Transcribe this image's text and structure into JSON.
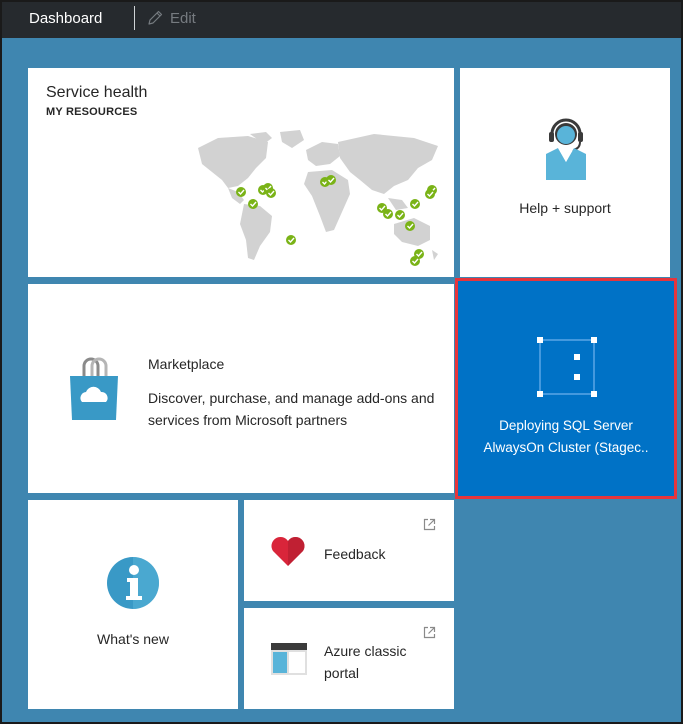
{
  "topbar": {
    "title": "Dashboard",
    "edit_label": "Edit"
  },
  "tiles": {
    "service_health": {
      "title": "Service health",
      "subtitle": "MY RESOURCES"
    },
    "help": {
      "label": "Help + support"
    },
    "marketplace": {
      "title": "Marketplace",
      "description": "Discover, purchase, and manage add-ons and services from Microsoft partners"
    },
    "deployment": {
      "label_line1": "Deploying SQL Server",
      "label_line2": "AlwaysOn Cluster (Stagec.."
    },
    "whats_new": {
      "label": "What's new"
    },
    "feedback": {
      "label": "Feedback"
    },
    "classic_portal": {
      "label_line1": "Azure classic",
      "label_line2": "portal"
    }
  },
  "icons": {
    "edit": "pencil-icon",
    "help": "support-agent-icon",
    "marketplace": "shopping-bag-cloud-icon",
    "deployment": "deployment-progress-icon",
    "whats_new": "info-icon",
    "feedback": "heart-icon",
    "classic_portal": "portal-window-icon",
    "external": "external-link-icon",
    "health_ok": "check-circle-icon"
  },
  "colors": {
    "topbar": "#262a2e",
    "dashboard_bg": "#3f86b0",
    "tile_bg": "#ffffff",
    "deploy_tile": "#0072c6",
    "selection_outline": "#e6353c",
    "health_ok": "#7ab317",
    "map_land": "#d2d2d2"
  }
}
